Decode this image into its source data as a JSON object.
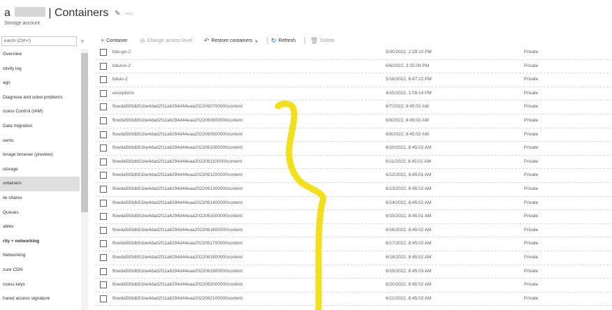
{
  "header": {
    "title_prefix": "a",
    "title_suffix": "| Containers",
    "subtitle": "Storage account",
    "pin_icon": "pin-icon",
    "more_icon": "more-icon"
  },
  "sidebar": {
    "search_placeholder": "earch (Ctrl+/)",
    "collapse_label": "«",
    "items": [
      {
        "label": "Overview"
      },
      {
        "label": "ctivity log"
      },
      {
        "label": "ags"
      },
      {
        "label": "Diagnose and solve problems"
      },
      {
        "label": "ccess Control (IAM)"
      },
      {
        "label": "Data migration"
      },
      {
        "label": "vents"
      },
      {
        "label": "torage browser (preview)"
      },
      {
        "label": "storage"
      },
      {
        "label": "ontainers",
        "active": true
      },
      {
        "label": "ile shares"
      },
      {
        "label": "Queues"
      },
      {
        "label": "ables"
      },
      {
        "label": "rity + networking",
        "section": true
      },
      {
        "label": "Networking"
      },
      {
        "label": "zure CDN"
      },
      {
        "label": "ccess keys"
      },
      {
        "label": "hared access signature"
      }
    ]
  },
  "toolbar": {
    "container": "Container",
    "change_access": "Change access level",
    "restore": "Restore containers",
    "refresh": "Refresh",
    "delete": "Delete"
  },
  "table": {
    "rows": [
      {
        "name": "bdu-go-2",
        "modified": "5/30/2022, 2:29:10 PM",
        "access": "Private"
      },
      {
        "name": "bdurun-2",
        "modified": "6/6/2022, 3:25:09 PM",
        "access": "Private"
      },
      {
        "name": "bduio-2",
        "modified": "5/16/2022, 6:47:22 PM",
        "access": "Private"
      },
      {
        "name": "exceptions",
        "modified": "4/15/2022, 1:09:14 PM",
        "access": "Private"
      },
      {
        "name": "flowda583db51be4dad2f11a6294d44eaa2022060700000content",
        "modified": "6/7/2022, 8:45:02 AM",
        "access": "Private"
      },
      {
        "name": "flowda583db51be4dad2f11a6294d44eaa2022060800000content",
        "modified": "6/8/2022, 8:45:02 AM",
        "access": "Private"
      },
      {
        "name": "flowda583db51be4dad2f11a6294d44eaa2022060900000content",
        "modified": "6/9/2022, 8:45:02 AM",
        "access": "Private"
      },
      {
        "name": "flowda583db51be4dad2f11a6294d44eaa2022061000000content",
        "modified": "6/10/2022, 8:45:02 AM",
        "access": "Private"
      },
      {
        "name": "flowda583db51be4dad2f11a6294d44eaa2022061100000content",
        "modified": "6/11/2022, 8:45:01 AM",
        "access": "Private"
      },
      {
        "name": "flowda583db51be4dad2f11a6294d44eaa2022061200000content",
        "modified": "6/12/2022, 8:45:01 AM",
        "access": "Private"
      },
      {
        "name": "flowda583db51be4dad2f11a6294d44eaa2022061300000content",
        "modified": "6/13/2022, 8:45:02 AM",
        "access": "Private"
      },
      {
        "name": "flowda583db51be4dad2f11a6294d44eaa2022061400000content",
        "modified": "6/14/2022, 8:45:02 AM",
        "access": "Private"
      },
      {
        "name": "flowda583db51be4dad2f11a6294d44eaa2022061500000content",
        "modified": "6/15/2022, 8:45:01 AM",
        "access": "Private"
      },
      {
        "name": "flowda583db51be4dad2f11a6294d44eaa2022061600000content",
        "modified": "6/16/2022, 8:45:02 AM",
        "access": "Private"
      },
      {
        "name": "flowda583db51be4dad2f11a6294d44eaa2022061700000content",
        "modified": "6/17/2022, 8:45:02 AM",
        "access": "Private"
      },
      {
        "name": "flowda583db51be4dad2f11a6294d44eaa2022061800000content",
        "modified": "6/18/2022, 8:45:02 AM",
        "access": "Private"
      },
      {
        "name": "flowda583db51be4dad2f11a6294d44eaa2022061900000content",
        "modified": "6/19/2022, 8:45:03 AM",
        "access": "Private"
      },
      {
        "name": "flowda583db51be4dad2f11a6294d44eaa2022062000000content",
        "modified": "6/20/2022, 8:45:02 AM",
        "access": "Private"
      },
      {
        "name": "flowda583db51be4dad2f11a6294d44eaa2022062100000content",
        "modified": "6/21/2022, 8:45:02 AM",
        "access": "Private"
      }
    ]
  },
  "colors": {
    "accent": "#0078d4",
    "annotation": "#f2dd00",
    "selected_row": "#e1dfdd"
  }
}
